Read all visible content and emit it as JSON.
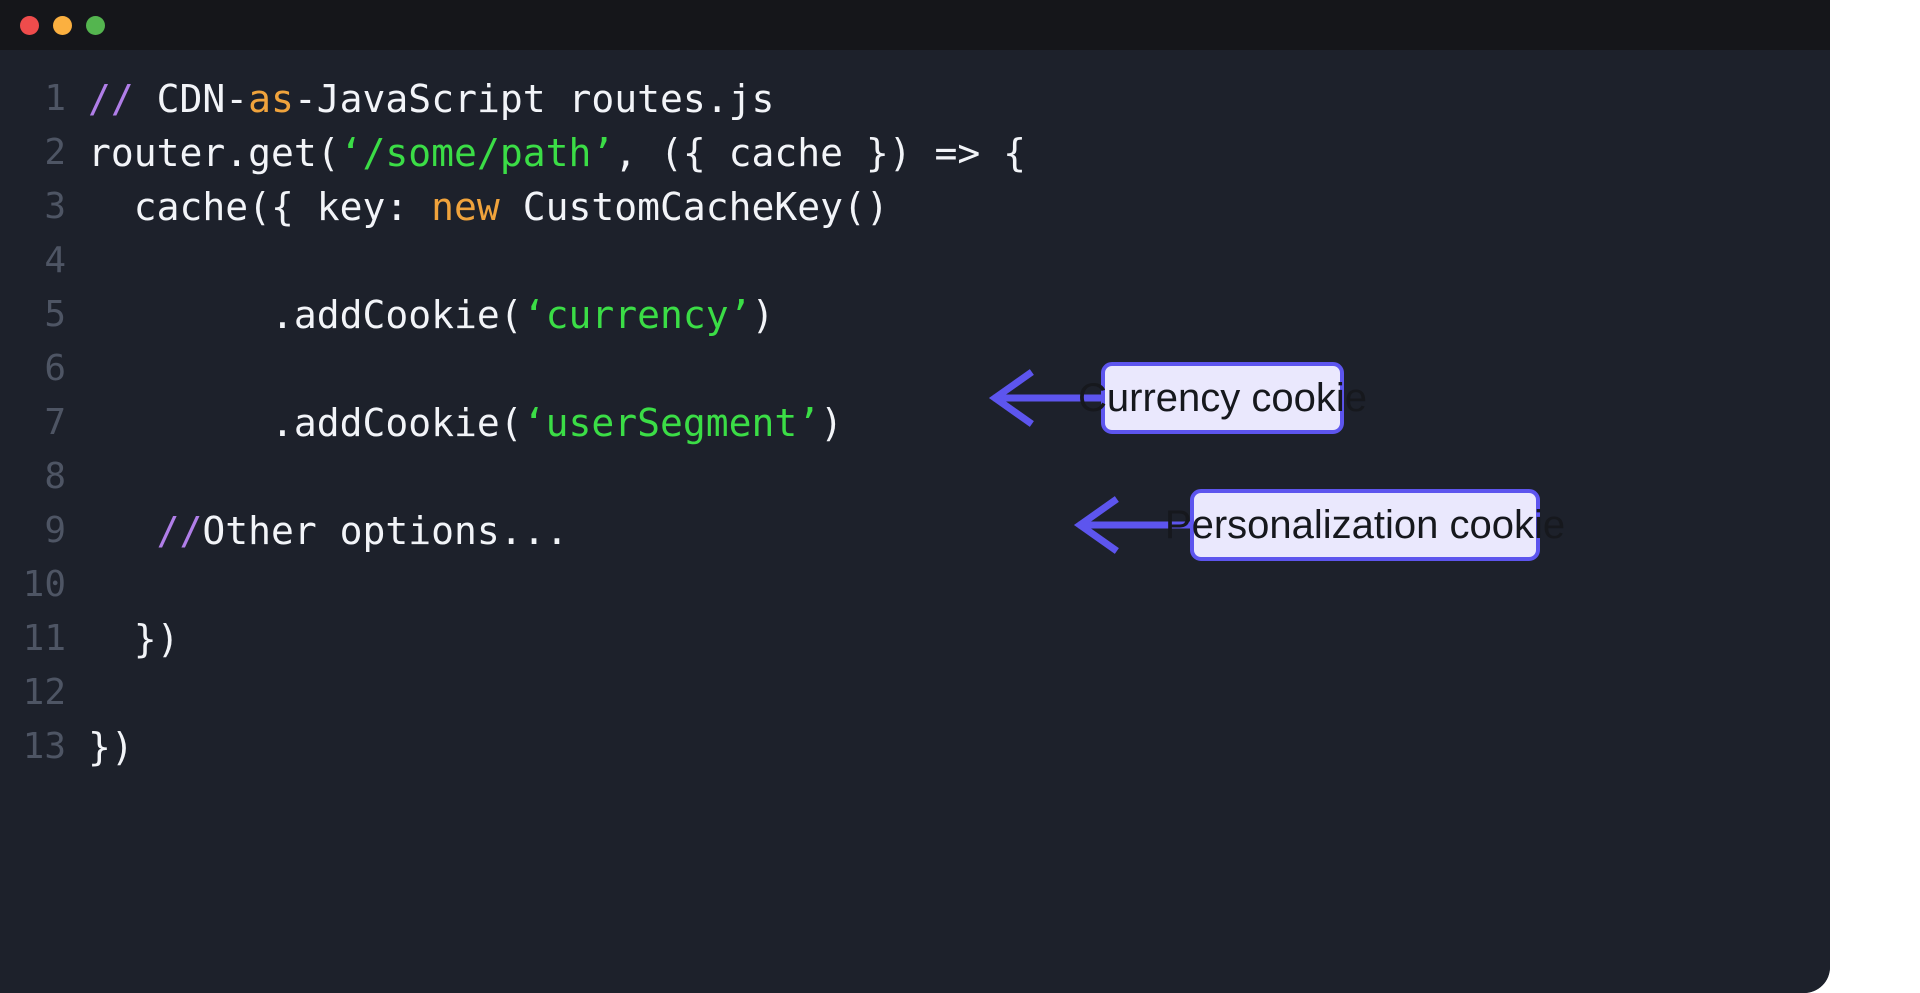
{
  "window": {
    "titlebar": {
      "buttons": [
        {
          "name": "close-button",
          "color": "#ef4c4c",
          "label": ""
        },
        {
          "name": "minimize-button",
          "color": "#fbb040",
          "label": ""
        },
        {
          "name": "maximize-button",
          "color": "#54b54f",
          "label": ""
        }
      ]
    }
  },
  "editor": {
    "background": "#1d212b",
    "gutter_color": "#4e5564",
    "default_text_color": "#f2f4f8",
    "syntax_colors": {
      "comment": "#b07ee8",
      "keyword": "#f0a33c",
      "string": "#3bdd46",
      "plain": "#f2f4f8"
    },
    "lines": [
      {
        "number": "1",
        "tokens": [
          {
            "type": "comment",
            "text": "// "
          },
          {
            "type": "plain",
            "text": "CDN-"
          },
          {
            "type": "keyword",
            "text": "as"
          },
          {
            "type": "plain",
            "text": "-JavaScript routes.js"
          }
        ]
      },
      {
        "number": "2",
        "tokens": [
          {
            "type": "plain",
            "text": "router.get("
          },
          {
            "type": "string",
            "text": "‘/some/path’"
          },
          {
            "type": "plain",
            "text": ", ({ cache }) => {"
          }
        ]
      },
      {
        "number": "3",
        "tokens": [
          {
            "type": "plain",
            "text": "  cache({ key: "
          },
          {
            "type": "keyword",
            "text": "new"
          },
          {
            "type": "plain",
            "text": " CustomCacheKey()"
          }
        ]
      },
      {
        "number": "4",
        "tokens": []
      },
      {
        "number": "5",
        "tokens": [
          {
            "type": "plain",
            "text": "        .addCookie("
          },
          {
            "type": "string",
            "text": "‘currency’"
          },
          {
            "type": "plain",
            "text": ")"
          }
        ]
      },
      {
        "number": "6",
        "tokens": []
      },
      {
        "number": "7",
        "tokens": [
          {
            "type": "plain",
            "text": "        .addCookie("
          },
          {
            "type": "string",
            "text": "‘userSegment’"
          },
          {
            "type": "plain",
            "text": ")"
          }
        ]
      },
      {
        "number": "8",
        "tokens": []
      },
      {
        "number": "9",
        "tokens": [
          {
            "type": "comment",
            "text": "   //"
          },
          {
            "type": "plain",
            "text": "Other options..."
          }
        ]
      },
      {
        "number": "10",
        "tokens": []
      },
      {
        "number": "11",
        "tokens": [
          {
            "type": "plain",
            "text": "  })"
          }
        ]
      },
      {
        "number": "12",
        "tokens": []
      },
      {
        "number": "13",
        "tokens": [
          {
            "type": "plain",
            "text": "})"
          }
        ]
      }
    ]
  },
  "annotations": {
    "accent_color": "#5d55ee",
    "fill_color": "#eae8fd",
    "text_color": "#16181d",
    "callouts": [
      {
        "id": "currency",
        "label": "Currency cookie",
        "points_to_line": "5"
      },
      {
        "id": "personalization",
        "label": "Personalization cookie",
        "points_to_line": "7"
      }
    ]
  }
}
